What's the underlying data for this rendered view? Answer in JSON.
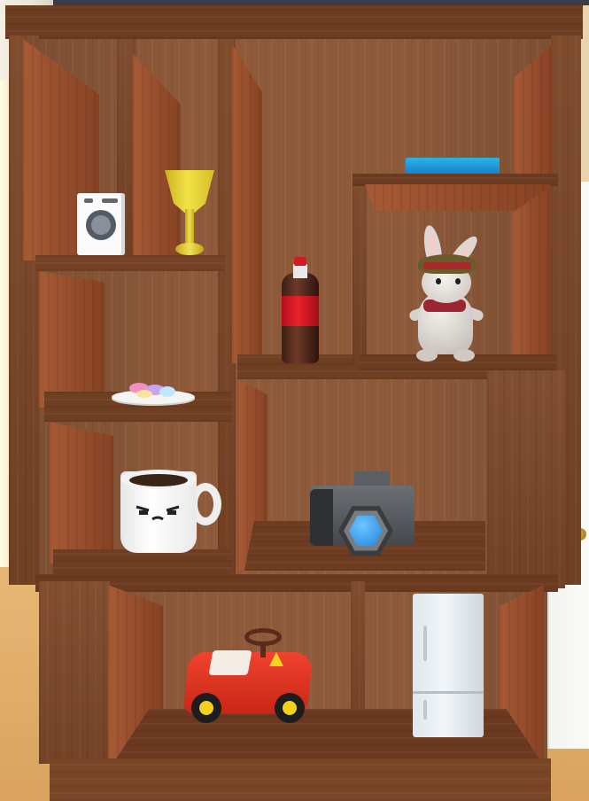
{
  "scene": {
    "name": "room-with-wooden-bookcase",
    "shelf_items": [
      {
        "name": "washing-machine-toy",
        "shelf": "top-left"
      },
      {
        "name": "golden-goblet",
        "shelf": "top-left"
      },
      {
        "name": "macarons-plate",
        "shelf": "middle-left"
      },
      {
        "name": "coffee-mug",
        "shelf": "lower-left"
      },
      {
        "name": "cola-bottle",
        "shelf": "top-center"
      },
      {
        "name": "blue-tray",
        "shelf": "top-right"
      },
      {
        "name": "bunny-plush",
        "shelf": "upper-right-box"
      },
      {
        "name": "camera",
        "shelf": "lower-center"
      },
      {
        "name": "toy-ride-on-car",
        "shelf": "bottom-left"
      },
      {
        "name": "mini-fridge",
        "shelf": "bottom-right"
      }
    ],
    "colors": {
      "wood": "#7a4526",
      "back_panel": "#8e5a3a",
      "floor": "#d9a35f",
      "wall": "#f0ebe0",
      "bottle_label": "#e8222e",
      "tray": "#1e9ad9",
      "car": "#e2372a",
      "lens": "#2f8ef0",
      "goblet": "#e6d23a"
    }
  }
}
